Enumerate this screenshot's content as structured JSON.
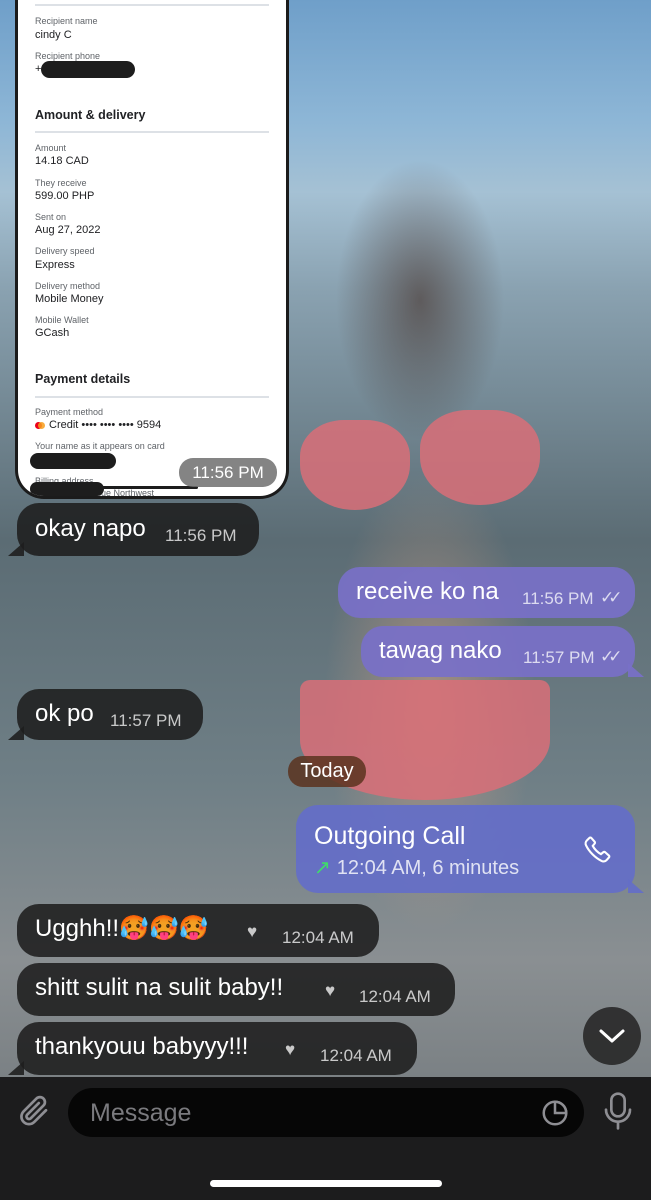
{
  "receipt": {
    "recipient_name_label": "Recipient name",
    "recipient_name": "cindy C",
    "recipient_phone_label": "Recipient phone",
    "recipient_phone_prefix": "+",
    "amount_section": "Amount & delivery",
    "amount_label": "Amount",
    "amount": "14.18 CAD",
    "they_receive_label": "They receive",
    "they_receive": "599.00 PHP",
    "sent_on_label": "Sent on",
    "sent_on": "Aug 27, 2022",
    "delivery_speed_label": "Delivery speed",
    "delivery_speed": "Express",
    "delivery_method_label": "Delivery method",
    "delivery_method": "Mobile Money",
    "mobile_wallet_label": "Mobile Wallet",
    "mobile_wallet": "GCash",
    "payment_section": "Payment details",
    "payment_method_label": "Payment method",
    "payment_method": "Credit •••• •••• •••• 9594",
    "name_on_card_label": "Your name as it appears on card",
    "billing_address_label": "Billing address",
    "billing_address_partial": "nue Northwest",
    "screenshot_time": "11:56 PM"
  },
  "messages": [
    {
      "text": "okay napo",
      "time": "11:56 PM",
      "dir": "in"
    },
    {
      "text": "receive ko na",
      "time": "11:56 PM",
      "dir": "out"
    },
    {
      "text": "tawag nako",
      "time": "11:57 PM",
      "dir": "out"
    },
    {
      "text": "ok po",
      "time": "11:57 PM",
      "dir": "in"
    }
  ],
  "date_separator": "Today",
  "call": {
    "title": "Outgoing Call",
    "detail": "12:04 AM, 6 minutes"
  },
  "messages_today": [
    {
      "text": "Ugghh!!🥵🥵🥵",
      "reaction": "♥",
      "time": "12:04 AM"
    },
    {
      "text": "shitt sulit na sulit baby!!",
      "reaction": "♥",
      "time": "12:04 AM"
    },
    {
      "text": "thankyouu babyyy!!!",
      "reaction": "♥",
      "time": "12:04 AM"
    }
  ],
  "composer": {
    "placeholder": "Message"
  },
  "colors": {
    "incoming_bubble": "#1e1e1e",
    "outgoing_bubble": "#7870c8",
    "reaction": "#e3101e",
    "call_arrow": "#3fdc6a"
  }
}
